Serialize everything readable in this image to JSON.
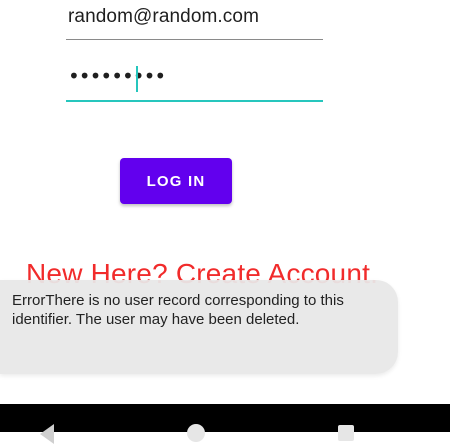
{
  "login_form": {
    "email_value": "random@random.com",
    "password_value": "•••••••••",
    "login_button_label": "LOG IN",
    "create_account_link": "New Here? Create Account."
  },
  "toast": {
    "message": "ErrorThere is no user record corresponding to this identifier. The user may have been deleted."
  },
  "navigation_bar": {
    "icons": [
      "back-icon",
      "home-icon",
      "recents-icon"
    ]
  },
  "colors": {
    "accent": "#26c6bd",
    "primary_button": "#6200ee",
    "link_red": "#f12b2b"
  }
}
